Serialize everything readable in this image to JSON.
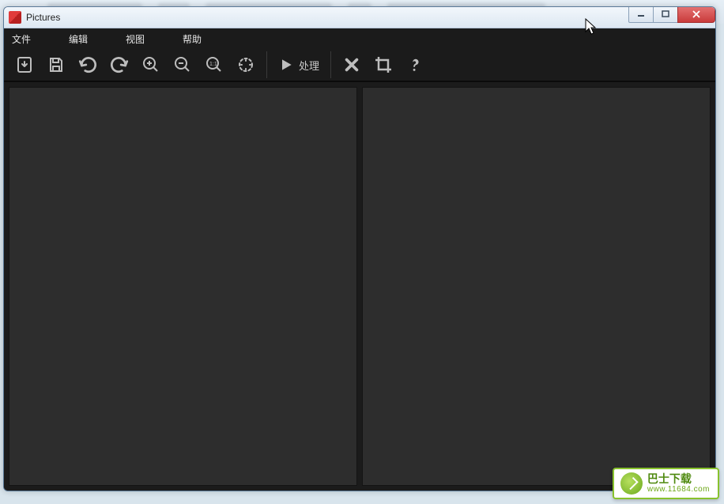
{
  "window": {
    "title": "Pictures"
  },
  "menu": {
    "file": "文件",
    "edit": "编辑",
    "view": "视图",
    "help": "帮助"
  },
  "toolbar": {
    "process_label": "处理"
  },
  "watermark": {
    "line1": "巴士下载",
    "line2": "www.11684.com"
  }
}
